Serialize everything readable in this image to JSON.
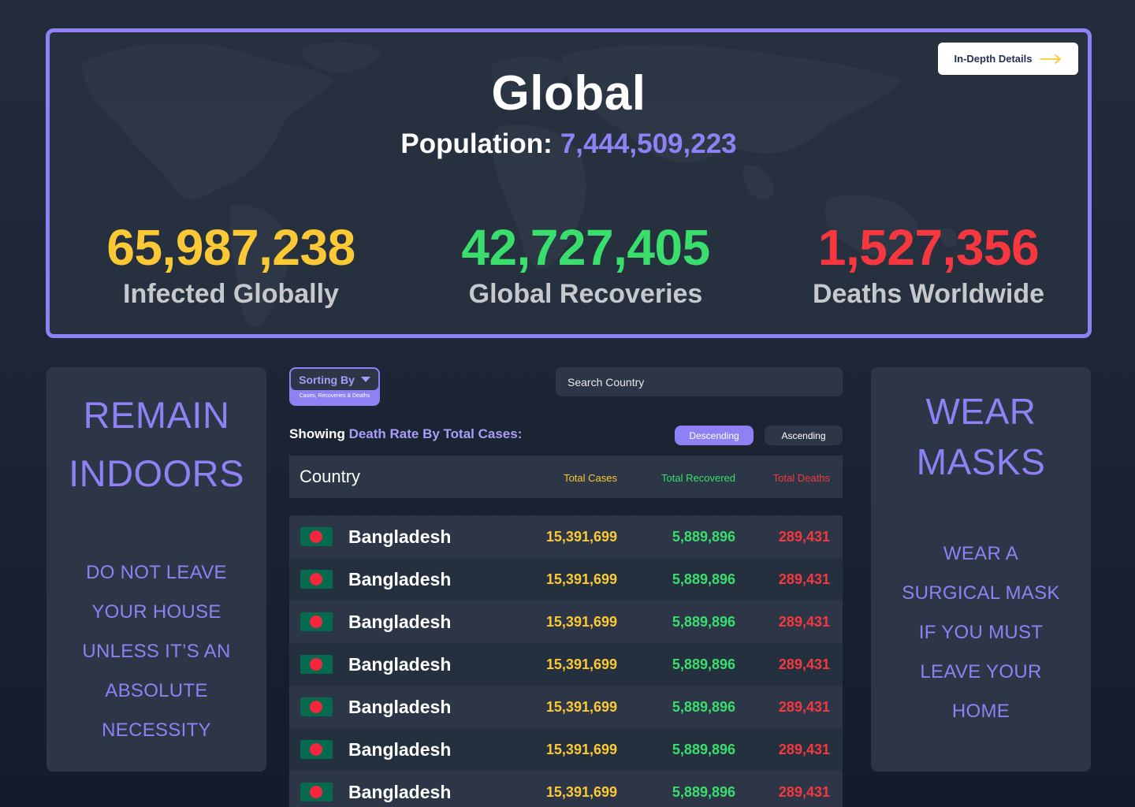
{
  "global": {
    "title": "Global",
    "population_label": "Population:",
    "population_value": "7,444,509,223",
    "details_button": "In-Depth Details",
    "stats": {
      "infected": {
        "value": "65,987,238",
        "label": "Infected Globally"
      },
      "recovered": {
        "value": "42,727,405",
        "label": "Global Recoveries"
      },
      "deaths": {
        "value": "1,527,356",
        "label": "Deaths Worldwide"
      }
    }
  },
  "left_card": {
    "heading_line1": "REMAIN",
    "heading_line2": "INDOORS",
    "body": [
      "DO NOT LEAVE",
      "YOUR HOUSE",
      "UNLESS IT’S AN",
      "ABSOLUTE",
      "NECESSITY"
    ]
  },
  "right_card": {
    "heading_line1": "WEAR",
    "heading_line2": "MASKS",
    "body": [
      "WEAR A",
      "SURGICAL MASK",
      "IF YOU MUST",
      "LEAVE YOUR",
      "HOME"
    ]
  },
  "controls": {
    "sort_label": "Sorting By",
    "sort_sub": "Cases, Recoveries & Deaths",
    "search_placeholder": "Search Country",
    "showing_prefix": "Showing",
    "showing_metric": "Death Rate By Total Cases:",
    "descending": "Descending",
    "ascending": "Ascending"
  },
  "table": {
    "headers": {
      "country": "Country",
      "cases": "Total Cases",
      "recovered": "Total Recovered",
      "deaths": "Total Deaths"
    },
    "rows": [
      {
        "country": "Bangladesh",
        "cases": "15,391,699",
        "recovered": "5,889,896",
        "deaths": "289,431"
      },
      {
        "country": "Bangladesh",
        "cases": "15,391,699",
        "recovered": "5,889,896",
        "deaths": "289,431"
      },
      {
        "country": "Bangladesh",
        "cases": "15,391,699",
        "recovered": "5,889,896",
        "deaths": "289,431"
      },
      {
        "country": "Bangladesh",
        "cases": "15,391,699",
        "recovered": "5,889,896",
        "deaths": "289,431"
      },
      {
        "country": "Bangladesh",
        "cases": "15,391,699",
        "recovered": "5,889,896",
        "deaths": "289,431"
      },
      {
        "country": "Bangladesh",
        "cases": "15,391,699",
        "recovered": "5,889,896",
        "deaths": "289,431"
      },
      {
        "country": "Bangladesh",
        "cases": "15,391,699",
        "recovered": "5,889,896",
        "deaths": "289,431"
      }
    ]
  },
  "colors": {
    "accent": "#8f81f4",
    "infected": "#fbc935",
    "recovered": "#3ade6c",
    "deaths": "#f5383f"
  }
}
